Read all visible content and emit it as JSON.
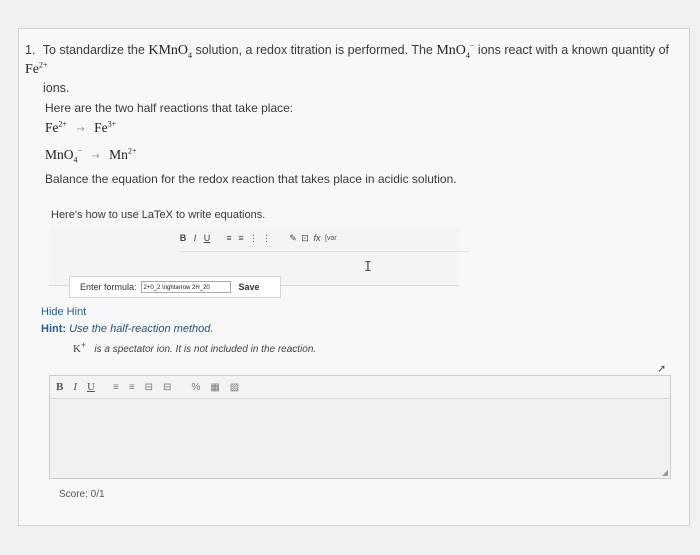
{
  "question": {
    "number": "1.",
    "text_pre": "To standardize the",
    "kmno4": "KMnO",
    "kmno4_sub": "4",
    "text_mid": "solution, a redox titration is performed. The",
    "mno4": "MnO",
    "mno4_sub": "4",
    "mno4_sup": "−",
    "text_mid2": "ions react with a known quantity of",
    "fe": "Fe",
    "fe_sup": "2+",
    "text_end": "ions."
  },
  "half_reactions": {
    "intro": "Here are the two half reactions that take place:",
    "r1_left": "Fe",
    "r1_left_sup": "2+",
    "r1_right": "Fe",
    "r1_right_sup": "3+",
    "r2_left": "MnO",
    "r2_left_sub": "4",
    "r2_left_sup": "−",
    "r2_right": "Mn",
    "r2_right_sup": "2+",
    "arrow": "→",
    "instruction": "Balance the equation for the redox reaction that takes place in acidic solution."
  },
  "latex": {
    "title": "Here's how to use LaTeX to write equations.",
    "toolbar": [
      "B",
      "I",
      "U",
      "≡",
      "≡",
      "⋮",
      "⋮",
      "✎",
      "⊡",
      "fx",
      "[var"
    ],
    "formula_label": "Enter formula:",
    "formula_value": "2+0_2 \\rightarrow 2H_20",
    "save_label": "Save"
  },
  "hint": {
    "hide_label": "Hide Hint",
    "label": "Hint:",
    "text": "Use the half-reaction method.",
    "spectator_ion": "K",
    "spectator_sup": "+",
    "spectator_text": "is a spectator ion. It is not included in the reaction."
  },
  "editor": {
    "bold": "B",
    "italic": "I",
    "underline": "U",
    "tools": [
      "≡",
      "≡",
      "⊟",
      "⊟",
      "%",
      "▦",
      "▨"
    ]
  },
  "score": "Score: 0/1"
}
